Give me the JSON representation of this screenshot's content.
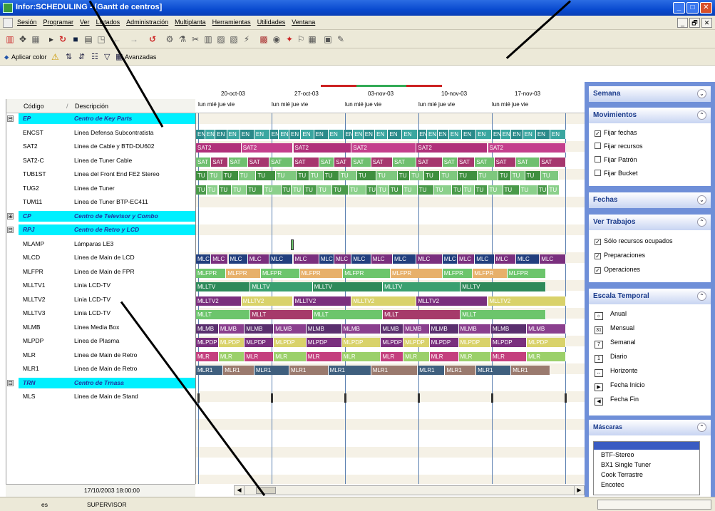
{
  "window": {
    "title": "Infor:SCHEDULING - [Gantt de centros]",
    "buttons": [
      "_",
      "□",
      "✕"
    ]
  },
  "menubar": {
    "items": [
      "Sesión",
      "Programar",
      "Ver",
      "Listados",
      "Administración",
      "Multiplanta",
      "Herramientas",
      "Utilidades",
      "Ventana"
    ],
    "mdi_buttons": [
      "_",
      "🗗",
      "✕"
    ]
  },
  "toolbar2": {
    "apply_color": "Aplicar color",
    "advanced": "Avanzadas"
  },
  "grid": {
    "columns": {
      "code": "Código",
      "desc": "Descripción"
    },
    "rows": [
      {
        "exp": "⊟",
        "code": "EP",
        "desc": "Centro de Key Parts",
        "group": true
      },
      {
        "code": "ENCST",
        "desc": "Linea Defensa Subcontratista"
      },
      {
        "code": "SAT2",
        "desc": "Linea de Cable y BTD-DU602"
      },
      {
        "code": "SAT2-C",
        "desc": "Linea de Tuner Cable"
      },
      {
        "code": "TUB1ST",
        "desc": "Linea del Front End FE2 Stereo"
      },
      {
        "code": "TUG2",
        "desc": "Linea de Tuner"
      },
      {
        "code": "TUM11",
        "desc": "Linea de Tuner BTP-EC411"
      },
      {
        "exp": "⊞",
        "code": "CP",
        "desc": "Centro de Televisor y Combo",
        "group": true
      },
      {
        "exp": "⊟",
        "code": "RPJ",
        "desc": "Centro de Retro y LCD",
        "group": true
      },
      {
        "code": "MLAMP",
        "desc": "Lámparas LE3"
      },
      {
        "code": "MLCD",
        "desc": "Linea de Main de LCD"
      },
      {
        "code": "MLFPR",
        "desc": "Linea de Main de FPR"
      },
      {
        "code": "MLLTV1",
        "desc": "Linia LCD-TV"
      },
      {
        "code": "MLLTV2",
        "desc": "Linia LCD-TV"
      },
      {
        "code": "MLLTV3",
        "desc": "Linia LCD-TV"
      },
      {
        "code": "MLMB",
        "desc": "Linea Media Box"
      },
      {
        "code": "MLPDP",
        "desc": "Linea de Plasma"
      },
      {
        "code": "MLR",
        "desc": "Linea de Main de Retro"
      },
      {
        "code": "MLR1",
        "desc": "Linea de Main de Retro"
      },
      {
        "exp": "⊟",
        "code": "TRN",
        "desc": "Centro de Trnasa",
        "group": true
      },
      {
        "code": "MLS",
        "desc": "Linea de Main de Stand"
      }
    ]
  },
  "gantt": {
    "weeks": [
      "20-oct-03",
      "27-oct-03",
      "03-nov-03",
      "10-nov-03",
      "17-nov-03"
    ],
    "days_label": "lun  mié jue vie",
    "rows": [
      {
        "bars": []
      },
      {
        "label": "EN",
        "color": "#2a8a8a",
        "alt": "#3aa6a0",
        "count": 30
      },
      {
        "label": "SAT2",
        "color": "#b0307a",
        "alt": "#c43f8c",
        "count": 6
      },
      {
        "label": "SAT",
        "color": "#6fbf6f",
        "alt": "#a6376e",
        "count": 18
      },
      {
        "label": "TU",
        "color": "#3f8f3f",
        "alt": "#7ec87e",
        "count": 22
      },
      {
        "label": "TU",
        "color": "#4a9a4a",
        "alt": "#8bd08b",
        "count": 26
      },
      {
        "bars": []
      },
      {
        "bars": []
      },
      {
        "bars": []
      },
      {
        "marker": true
      },
      {
        "label": "MLC",
        "color": "#223f7e",
        "alt": "#7a2f7e",
        "count": 18
      },
      {
        "label": "MLFPR",
        "color": "#6cc56c",
        "alt": "#e7b06a",
        "count": 9
      },
      {
        "label": "MLLTV",
        "color": "#2e8a5a",
        "alt": "#3aa070",
        "count": 5
      },
      {
        "label": "MLLTV2",
        "color": "#7a2f7e",
        "alt": "#d9d26a",
        "count": 6
      },
      {
        "label": "MLLT",
        "color": "#6cc56c",
        "alt": "#a63a6a",
        "count": 5
      },
      {
        "label": "MLMB",
        "color": "#5a2f6e",
        "alt": "#8a3f8e",
        "count": 12
      },
      {
        "label": "MLPDP",
        "color": "#7a2f7e",
        "alt": "#d9d26a",
        "count": 12
      },
      {
        "label": "MLR",
        "color": "#c43f7e",
        "alt": "#9bd06a",
        "count": 12
      },
      {
        "label": "MLR1",
        "color": "#3f5f7e",
        "alt": "#9a7a6e",
        "count": 10
      },
      {
        "bars": []
      },
      {
        "ticks": true
      }
    ]
  },
  "sidepanel": {
    "semana": "Semana",
    "movimientos": {
      "title": "Movimientos",
      "items": [
        {
          "label": "Fijar fechas",
          "checked": true
        },
        {
          "label": "Fijar recursos",
          "checked": false
        },
        {
          "label": "Fijar Patrón",
          "checked": false
        },
        {
          "label": "Fijar Bucket",
          "checked": false
        }
      ]
    },
    "fechas": "Fechas",
    "ver_trabajos": {
      "title": "Ver Trabajos",
      "items": [
        {
          "label": "Sólo recursos ocupados",
          "checked": true
        },
        {
          "label": "Preparaciones",
          "checked": true
        },
        {
          "label": "Operaciones",
          "checked": true
        }
      ]
    },
    "escala": {
      "title": "Escala Temporal",
      "items": [
        {
          "icon": "☼",
          "label": "Anual"
        },
        {
          "icon": "31",
          "label": "Mensual"
        },
        {
          "icon": "7",
          "label": "Semanal"
        },
        {
          "icon": "1",
          "label": "Diario"
        },
        {
          "icon": "↔",
          "label": "Horizonte"
        },
        {
          "icon": "▶",
          "label": "Fecha Inicio"
        },
        {
          "icon": "◀",
          "label": "Fecha Fin"
        }
      ]
    },
    "mascaras": {
      "title": "Máscaras",
      "items": [
        "BTF-Stereo",
        "BX1 Single Tuner",
        "Cook Terrastre",
        "Encotec"
      ]
    }
  },
  "status": {
    "date": "17/10/2003 18:00:00",
    "left": "es",
    "user": "SUPERVISOR"
  }
}
